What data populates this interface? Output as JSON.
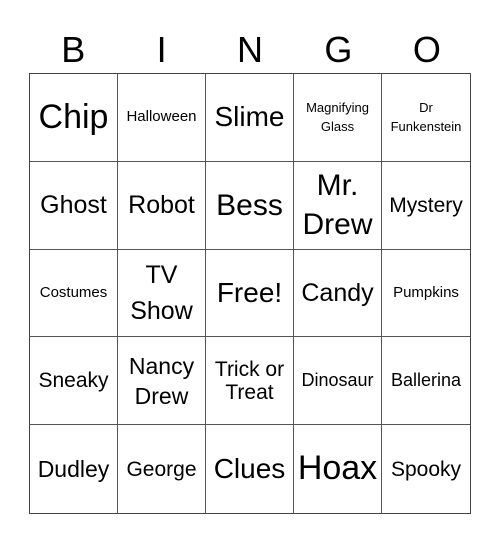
{
  "header": [
    "B",
    "I",
    "N",
    "G",
    "O"
  ],
  "cells": [
    {
      "text": "Chip",
      "size": "s34"
    },
    {
      "text": "Halloween",
      "size": "s15"
    },
    {
      "text": "Slime",
      "size": "s28"
    },
    {
      "text": "Magnifying Glass",
      "size": "s13"
    },
    {
      "text": "Dr Funkenstein",
      "size": "s13"
    },
    {
      "text": "Ghost",
      "size": "s24"
    },
    {
      "text": "Robot",
      "size": "s24"
    },
    {
      "text": "Bess",
      "size": "s30"
    },
    {
      "text": "Mr. Drew",
      "size": "s30"
    },
    {
      "text": "Mystery",
      "size": "s20"
    },
    {
      "text": "Costumes",
      "size": "s15"
    },
    {
      "text": "TV Show",
      "size": "s24"
    },
    {
      "text": "Free!",
      "size": "s28"
    },
    {
      "text": "Candy",
      "size": "s24"
    },
    {
      "text": "Pumpkins",
      "size": "s15"
    },
    {
      "text": "Sneaky",
      "size": "s20"
    },
    {
      "text": "Nancy Drew",
      "size": "s22"
    },
    {
      "text": "Trick or Treat",
      "size": "s20"
    },
    {
      "text": "Dinosaur",
      "size": "s18"
    },
    {
      "text": "Ballerina",
      "size": "s18"
    },
    {
      "text": "Dudley",
      "size": "s22"
    },
    {
      "text": "George",
      "size": "s20"
    },
    {
      "text": "Clues",
      "size": "s28"
    },
    {
      "text": "Hoax",
      "size": "s34"
    },
    {
      "text": "Spooky",
      "size": "s20"
    }
  ]
}
